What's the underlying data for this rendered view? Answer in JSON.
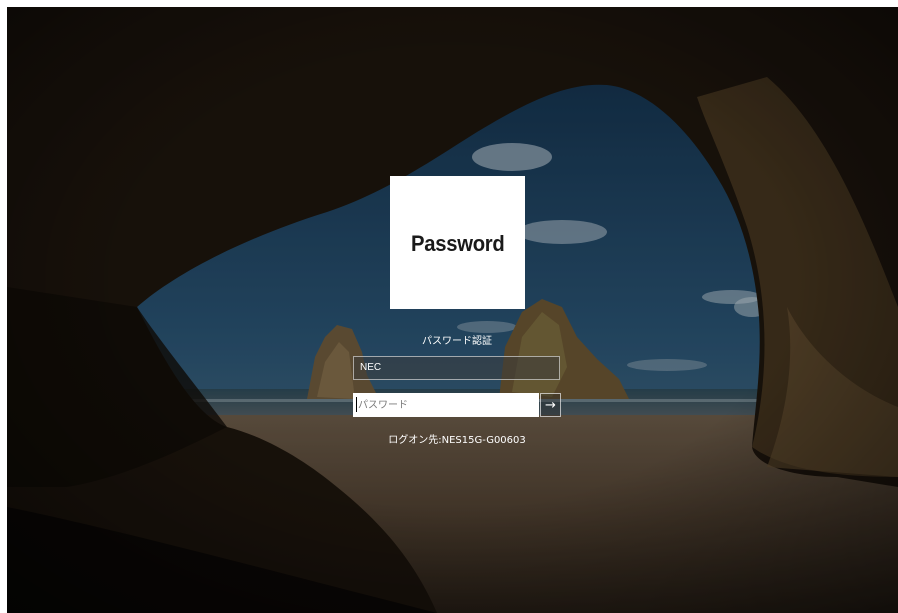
{
  "tile": {
    "label": "Password",
    "background": "#ffffff"
  },
  "auth": {
    "label": "パスワード認証"
  },
  "username": {
    "value": "NEC"
  },
  "password": {
    "placeholder": "パスワード",
    "value": ""
  },
  "submit": {
    "icon": "arrow-right-icon",
    "glyph": "→"
  },
  "logon": {
    "target_text": "ログオン先:NES15G-G00603"
  },
  "colors": {
    "text": "#ffffff",
    "field_border": "#ffffff",
    "overlay": "#000000"
  }
}
